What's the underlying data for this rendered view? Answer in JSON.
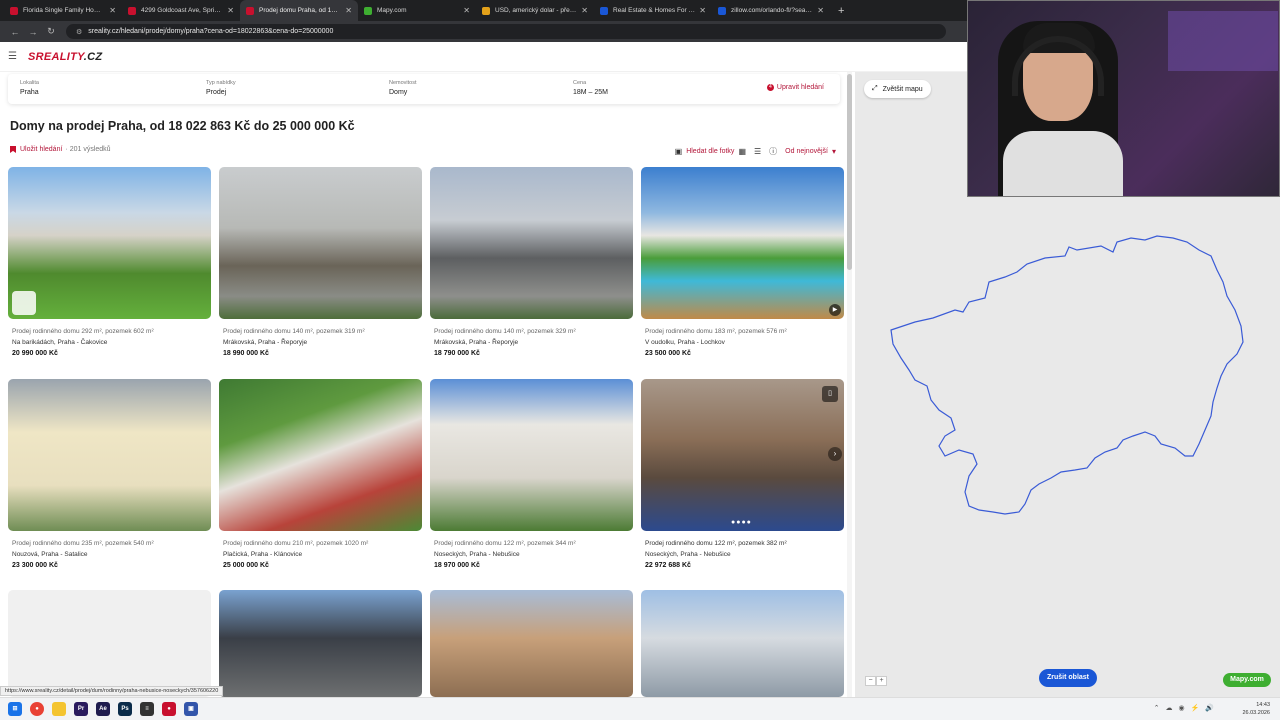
{
  "browser": {
    "tabs": [
      {
        "label": "Florida Single Family Homes fo",
        "color": "#c8102e"
      },
      {
        "label": "4299 Goldcoast Ave, Spring Hil",
        "color": "#c8102e"
      },
      {
        "label": "Prodej domu Praha, od 18 022",
        "color": "#c8102e"
      },
      {
        "label": "Mapy.com",
        "color": "#3eae31"
      },
      {
        "label": "USD, americký dolar - převod n",
        "color": "#e3a11a"
      },
      {
        "label": "Real Estate & Homes For Sale",
        "color": "#1a57d6"
      },
      {
        "label": "zillow.com/orlando-fl/?searchQ",
        "color": "#1a57d6"
      }
    ],
    "url": "sreality.cz/hledani/prodej/domy/praha?cena-od=18022863&cena-do=25000000"
  },
  "site": {
    "logo_main": "SREALITY",
    "logo_suffix": ".CZ"
  },
  "filters": {
    "locality_label": "Lokalita",
    "locality_value": "Praha",
    "offer_label": "Typ nabídky",
    "offer_value": "Prodej",
    "property_label": "Nemovitost",
    "property_value": "Domy",
    "price_label": "Cena",
    "price_value": "18M – 25M",
    "edit_badge": "4",
    "edit_label": "Upravit hledání"
  },
  "page_title": "Domy na prodej Praha, od 18 022 863 Kč do 25 000 000 Kč",
  "toolbar": {
    "save_label": "Uložit hledání",
    "result_count": "· 201 výsledků",
    "photo_search": "Hledat dle fotky",
    "sort": "Od nejnovější"
  },
  "listings": [
    {
      "title": "Prodej rodinného domu 292 m², pozemek 602 m²",
      "address": "Na barikádách, Praha - Čakovice",
      "price": "20 990 000 Kč"
    },
    {
      "title": "Prodej rodinného domu 140 m², pozemek 319 m²",
      "address": "Mrákovská, Praha - Řeporyje",
      "price": "18 990 000 Kč"
    },
    {
      "title": "Prodej rodinného domu 140 m², pozemek 329 m²",
      "address": "Mrákovská, Praha - Řeporyje",
      "price": "18 790 000 Kč"
    },
    {
      "title": "Prodej rodinného domu 183 m², pozemek 576 m²",
      "address": "V oudolku, Praha - Lochkov",
      "price": "23 500 000 Kč"
    },
    {
      "title": "Prodej rodinného domu 235 m², pozemek 540 m²",
      "address": "Nouzová, Praha - Satalice",
      "price": "23 300 000 Kč"
    },
    {
      "title": "Prodej rodinného domu 210 m², pozemek 1020 m²",
      "address": "Plačická, Praha - Klánovice",
      "price": "25 000 000 Kč"
    },
    {
      "title": "Prodej rodinného domu 122 m², pozemek 344 m²",
      "address": "Noseckých, Praha - Nebušice",
      "price": "18 970 000 Kč"
    },
    {
      "title": "Prodej rodinného domu 122 m², pozemek 382 m²",
      "address": "Noseckých, Praha - Nebušice",
      "price": "22 972 688 Kč"
    }
  ],
  "map": {
    "enlarge": "Zvětšit mapu",
    "cancel_area": "Zrušit oblast",
    "provider": "Mapy.com",
    "zoom_out": "−",
    "zoom_in": "+"
  },
  "status_url": "https://www.sreality.cz/detail/prodej/dum/rodinny/praha-nebusice-noseckych/357606220",
  "taskbar": {
    "time": "14:43",
    "date": "26.03.2026"
  }
}
